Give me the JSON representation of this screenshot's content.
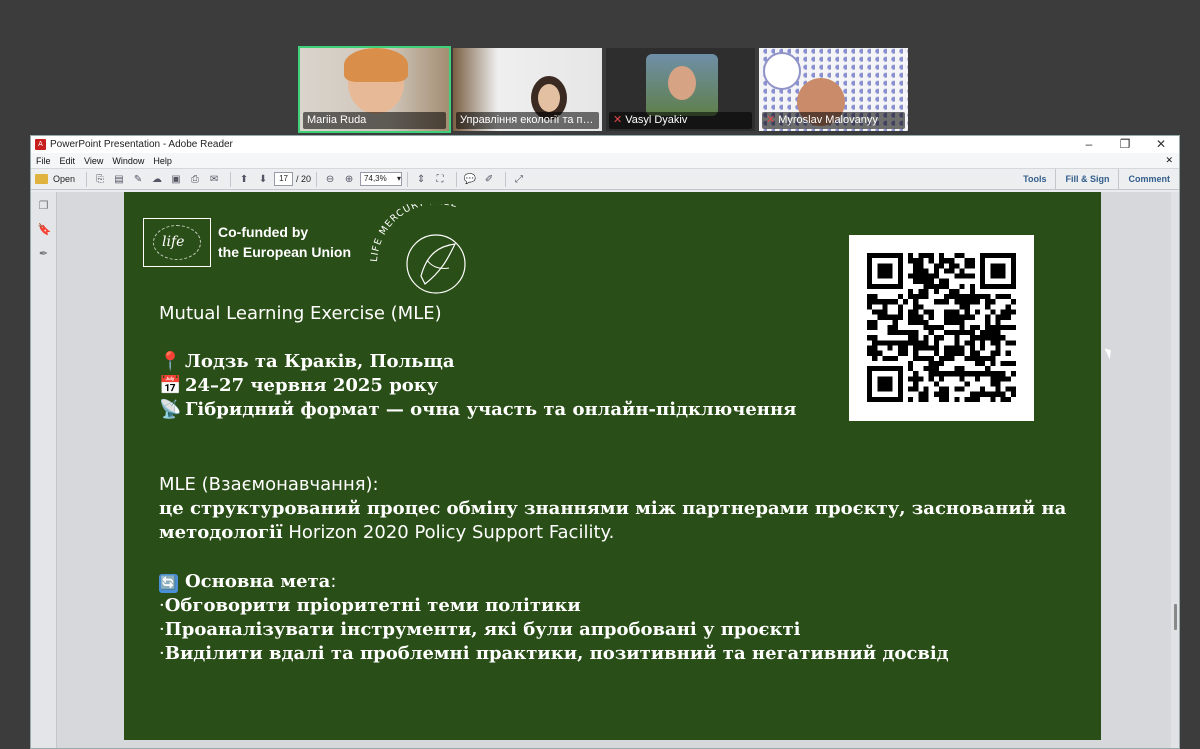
{
  "participants": [
    {
      "name": "Mariia Ruda",
      "muted": false,
      "active": true
    },
    {
      "name": "Управління екології та пр...",
      "muted": false,
      "active": false
    },
    {
      "name": "Vasyl  Dyakiv",
      "muted": true,
      "active": false
    },
    {
      "name": "Myroslav Malovanyy",
      "muted": true,
      "active": false
    }
  ],
  "window": {
    "title": "PowerPoint Presentation - Adobe Reader",
    "menu": [
      "File",
      "Edit",
      "View",
      "Window",
      "Help"
    ],
    "toolbar": {
      "open_label": "Open",
      "current_page": "17",
      "total_pages": "/ 20",
      "zoom": "74,3%",
      "right_buttons": [
        "Tools",
        "Fill & Sign",
        "Comment"
      ]
    }
  },
  "slide": {
    "cofunded_line1": "Co-funded by",
    "cofunded_line2": "the European Union",
    "logo_text": "life",
    "mercury_text": "LIFE MERCURY FREE",
    "heading": "Mutual Learning Exercise (MLE)",
    "location_icon": "📍",
    "location": "Лодзь та Краків, Польща",
    "date_icon": "📅",
    "dates": "24–27 червня 2025 року",
    "format_icon": "📡",
    "format": "Гібридний формат — очна участь та онлайн-підключення",
    "mle_title": "MLE (Взаємонавчання):",
    "mle_desc_line1": "це структурований процес обміну знаннями між партнерами проєкту, заснований на",
    "mle_desc_line2_bold": "методології",
    "mle_desc_line2_rest": " Horizon 2020 Policy Support Facility.",
    "goal_icon": "🔄",
    "goal_title": "Основна мета",
    "goal_colon": ":",
    "goals": [
      "Обговорити пріоритетні теми політики",
      "Проаналізувати інструменти, які були апробовані у проєкті",
      "Виділити вдалі та проблемні практики, позитивний та негативний досвід"
    ]
  }
}
